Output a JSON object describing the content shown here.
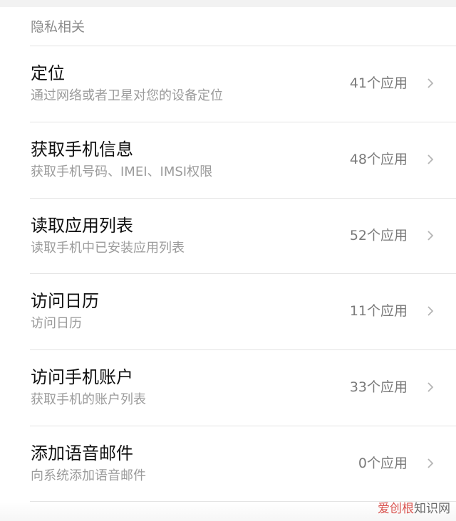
{
  "section": {
    "title": "隐私相关"
  },
  "items": [
    {
      "title": "定位",
      "subtitle": "通过网络或者卫星对您的设备定位",
      "count": "41个应用",
      "icon": "chevron-right-icon"
    },
    {
      "title": "获取手机信息",
      "subtitle": "获取手机号码、IMEI、IMSI权限",
      "count": "48个应用",
      "icon": "chevron-right-icon"
    },
    {
      "title": "读取应用列表",
      "subtitle": "读取手机中已安装应用列表",
      "count": "52个应用",
      "icon": "chevron-right-icon"
    },
    {
      "title": "访问日历",
      "subtitle": "访问日历",
      "count": "11个应用",
      "icon": "chevron-right-icon"
    },
    {
      "title": "访问手机账户",
      "subtitle": "获取手机的账户列表",
      "count": "33个应用",
      "icon": "chevron-right-icon"
    },
    {
      "title": "添加语音邮件",
      "subtitle": "向系统添加语音邮件",
      "count": "0个应用",
      "icon": "chevron-right-icon"
    }
  ],
  "watermark": {
    "brand": "爱创根",
    "suffix": "知识网"
  },
  "colors": {
    "title": "#111111",
    "subtitle": "#9b9b9b",
    "count": "#7a7a7a",
    "chevron": "#b5b5b5",
    "divider": "#e3e3e3",
    "watermark_brand": "#d9534f"
  }
}
